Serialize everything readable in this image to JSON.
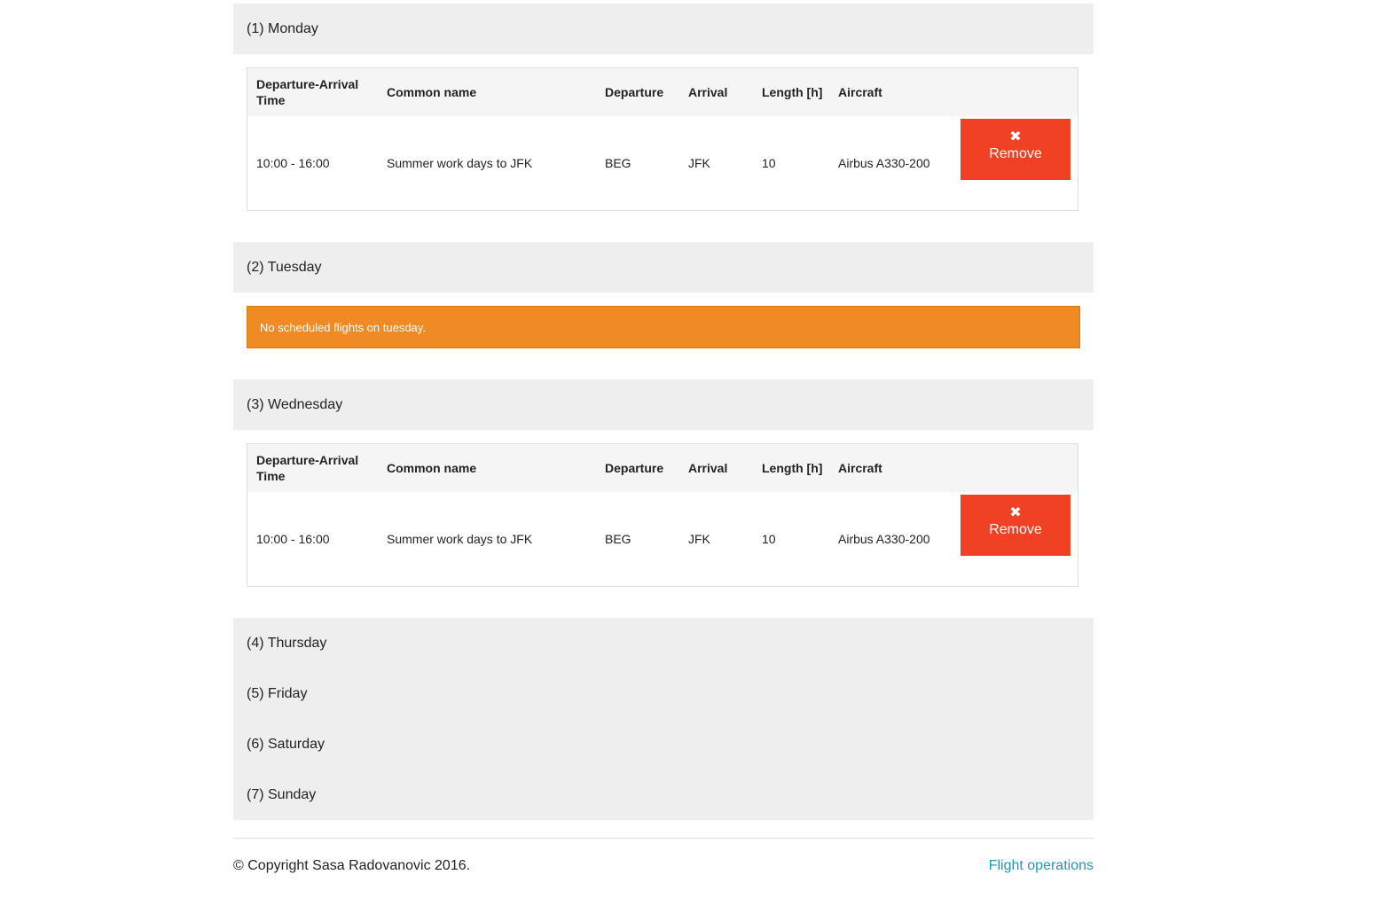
{
  "days": {
    "monday": {
      "title": "(1) Monday",
      "columns": [
        "Departure-Arrival Time",
        "Common name",
        "Departure",
        "Arrival",
        "Length [h]",
        "Aircraft"
      ],
      "rows": [
        {
          "time": "10:00 - 16:00",
          "name": "Summer work days to JFK",
          "departure": "BEG",
          "arrival": "JFK",
          "length": "10",
          "aircraft": "Airbus A330-200",
          "remove_label": "Remove"
        }
      ]
    },
    "tuesday": {
      "title": "(2) Tuesday",
      "alert": "No scheduled flights on tuesday."
    },
    "wednesday": {
      "title": "(3) Wednesday",
      "columns": [
        "Departure-Arrival Time",
        "Common name",
        "Departure",
        "Arrival",
        "Length [h]",
        "Aircraft"
      ],
      "rows": [
        {
          "time": "10:00 - 16:00",
          "name": "Summer work days to JFK",
          "departure": "BEG",
          "arrival": "JFK",
          "length": "10",
          "aircraft": "Airbus A330-200",
          "remove_label": "Remove"
        }
      ]
    },
    "thursday": {
      "title": "(4) Thursday"
    },
    "friday": {
      "title": "(5) Friday"
    },
    "saturday": {
      "title": "(6) Saturday"
    },
    "sunday": {
      "title": "(7) Sunday"
    }
  },
  "icons": {
    "remove": "close-icon"
  },
  "colors": {
    "remove_button": "#f04124",
    "alert": "#f08a24",
    "link": "#2795b6",
    "panel": "#eeeeee"
  },
  "footer": {
    "copyright": "© Copyright Sasa Radovanovic 2016.",
    "link": "Flight operations"
  }
}
